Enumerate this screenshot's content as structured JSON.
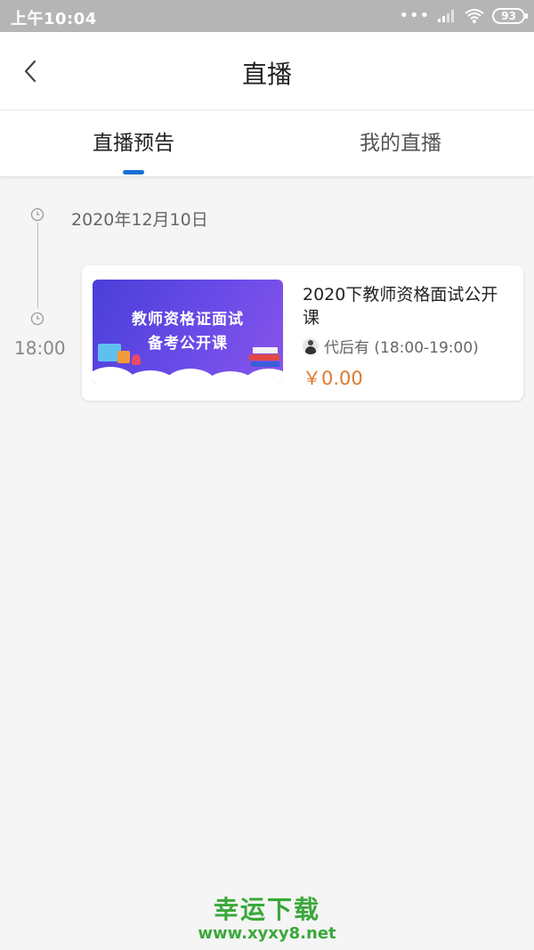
{
  "status_bar": {
    "time": "上午10:04",
    "battery": "93",
    "icons": [
      "signal-icon",
      "wifi-icon",
      "battery-icon"
    ]
  },
  "header": {
    "title": "直播",
    "back_icon": "chevron-left-icon"
  },
  "tabs": [
    {
      "label": "直播预告",
      "active": true
    },
    {
      "label": "我的直播",
      "active": false
    }
  ],
  "schedule": {
    "date": "2020年12月10日",
    "time": "18:00",
    "card": {
      "thumbnail_line1": "教师资格证面试",
      "thumbnail_line2": "备考公开课",
      "title": "2020下教师资格面试公开课",
      "teacher": "代后有 (18:00-19:00)",
      "price": "￥0.00"
    }
  },
  "watermark": {
    "name": "幸运下载",
    "url": "www.xyxy8.net"
  },
  "colors": {
    "accent": "#1a6fd6",
    "price": "#e07a2e",
    "watermark": "#3aa83a",
    "status_bar": "#b5b5b5"
  }
}
